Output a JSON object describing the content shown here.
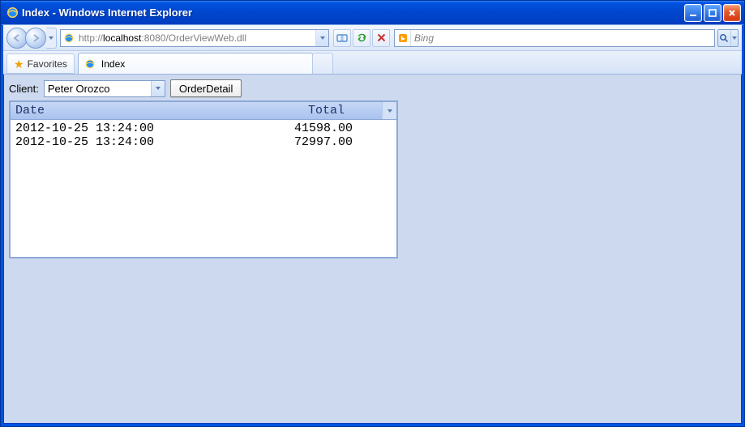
{
  "window": {
    "title": "Index - Windows Internet Explorer"
  },
  "nav": {
    "url_prefix": "http://",
    "url_host": "localhost",
    "url_port": ":8080",
    "url_path": "/OrderViewWeb.dll",
    "search_provider": "Bing"
  },
  "tabs": {
    "favorites_label": "Favorites",
    "active_tab_title": "Index"
  },
  "page": {
    "client_label": "Client:",
    "client_value": "Peter Orozco",
    "detail_button": "OrderDetail",
    "grid_header_date": "Date",
    "grid_header_total": "Total",
    "rows": [
      {
        "date": "2012-10-25 13:24:00",
        "total": "41598.00"
      },
      {
        "date": "2012-10-25 13:24:00",
        "total": "72997.00"
      }
    ]
  }
}
